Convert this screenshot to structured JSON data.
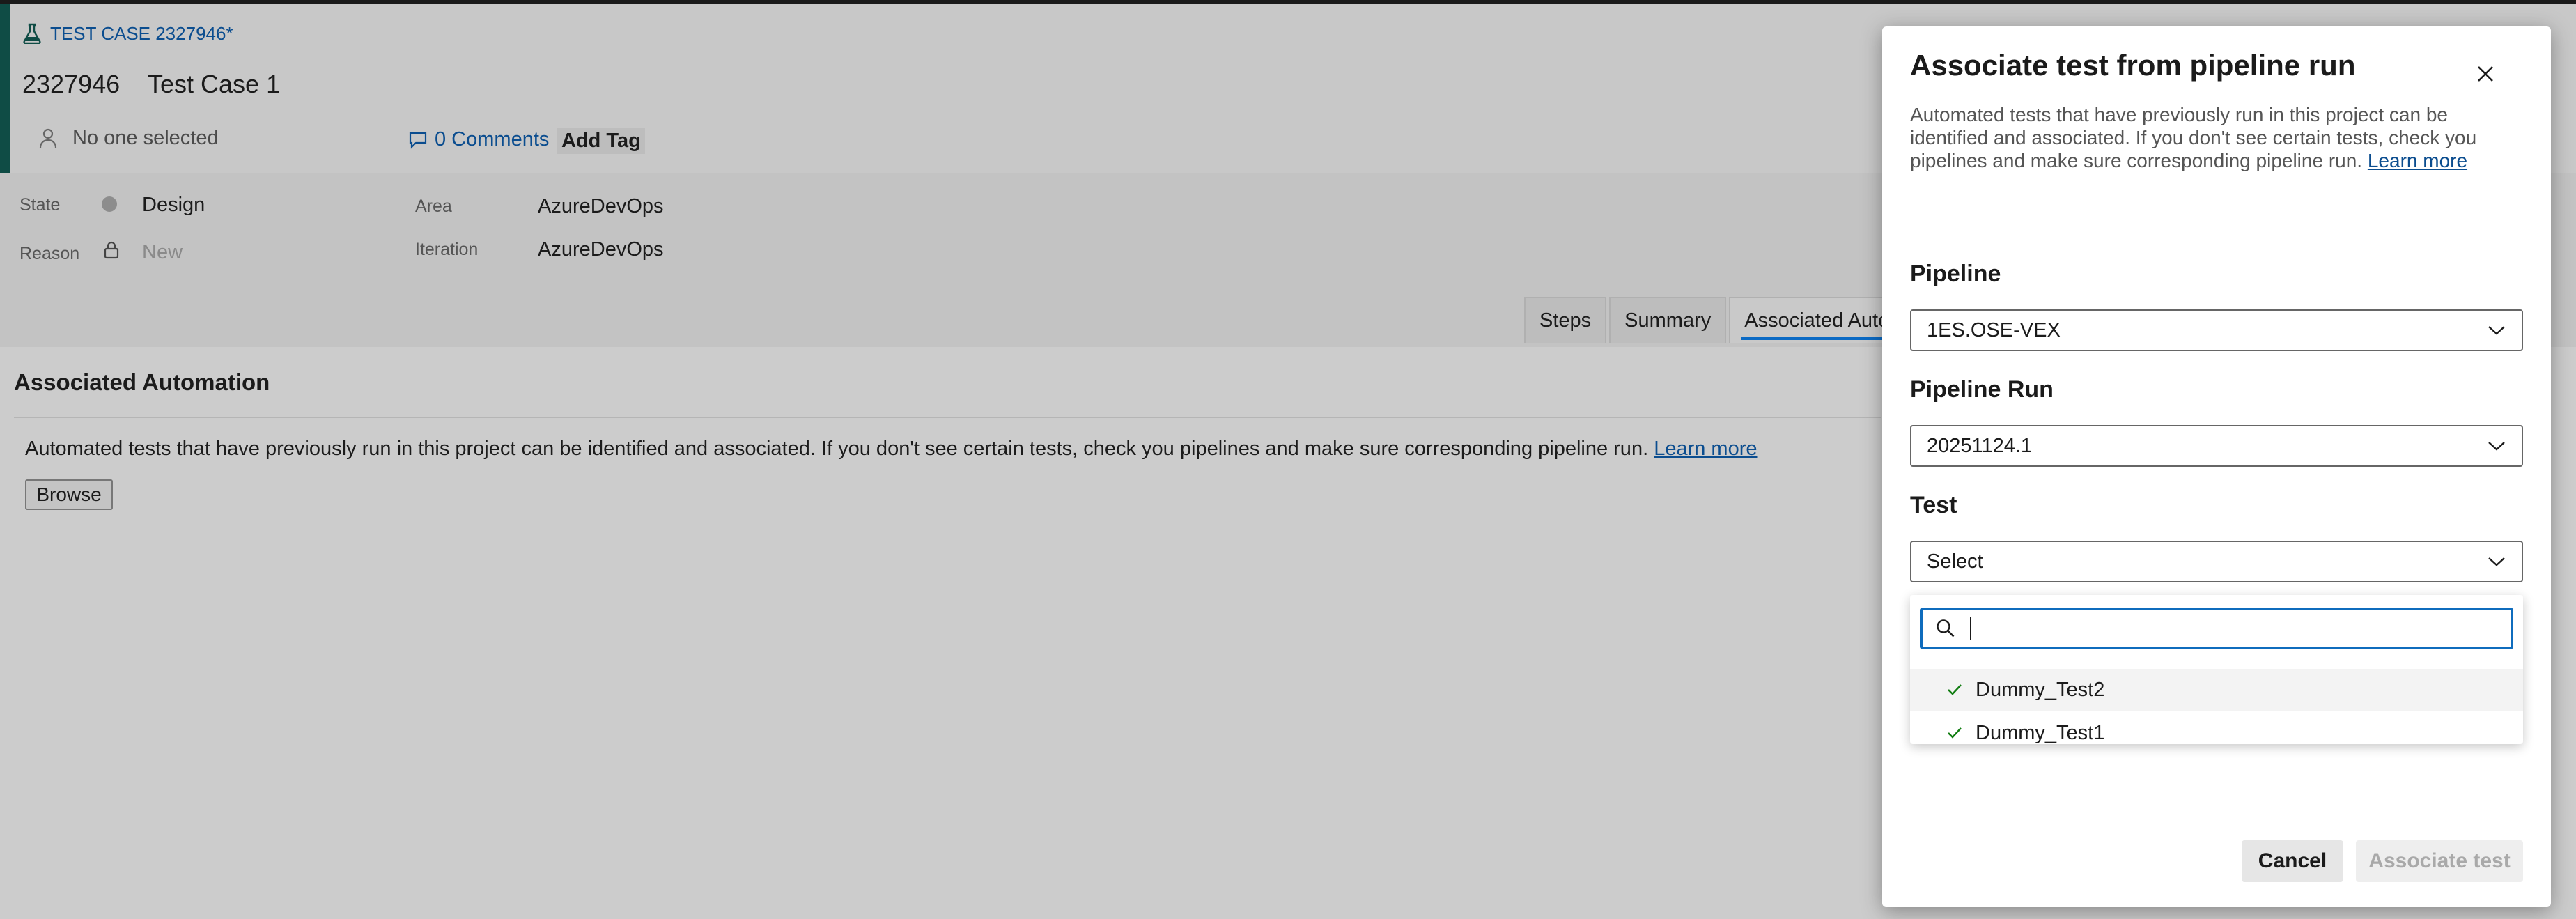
{
  "work_item": {
    "type_label": "TEST CASE 2327946*",
    "id": "2327946",
    "title": "Test Case 1",
    "assignee": "No one selected",
    "comments_label": "0 Comments",
    "add_tag_label": "Add Tag"
  },
  "fields": {
    "state_label": "State",
    "state_value": "Design",
    "reason_label": "Reason",
    "reason_value": "New",
    "area_label": "Area",
    "area_value": "AzureDevOps",
    "iteration_label": "Iteration",
    "iteration_value": "AzureDevOps"
  },
  "tabs": [
    {
      "label": "Steps"
    },
    {
      "label": "Summary"
    },
    {
      "label": "Associated Automation"
    }
  ],
  "automation": {
    "title": "Associated Automation",
    "description": "Automated tests that have previously run in this project can be identified and associated. If you don't see certain tests, check you pipelines and make sure corresponding pipeline run.",
    "learn_more": "Learn more",
    "browse_label": "Browse"
  },
  "modal": {
    "title": "Associate test from pipeline run",
    "description": "Automated tests that have previously run in this project can be identified and associated. If you don't see certain tests, check you pipelines and make sure corresponding pipeline run.",
    "learn_more": "Learn more",
    "pipeline_label": "Pipeline",
    "pipeline_value": "1ES.OSE-VEX",
    "pipeline_run_label": "Pipeline Run",
    "pipeline_run_value": "20251124.1",
    "test_label": "Test",
    "test_value": "Select",
    "search_value": "",
    "test_options": [
      {
        "label": "Dummy_Test2"
      },
      {
        "label": "Dummy_Test1"
      }
    ],
    "cancel_label": "Cancel",
    "associate_label": "Associate test"
  },
  "colors": {
    "accent_bar": "#0f4c45",
    "link": "#0b4d8f",
    "focus_border": "#0f6cbd",
    "check": "#107c10"
  },
  "icons": {
    "type_icon": "flask-icon",
    "assignee_icon": "person-icon",
    "comments_icon": "comment-icon",
    "close_icon": "close-icon",
    "search_icon": "search-icon",
    "check_icon": "checkmark-icon"
  }
}
